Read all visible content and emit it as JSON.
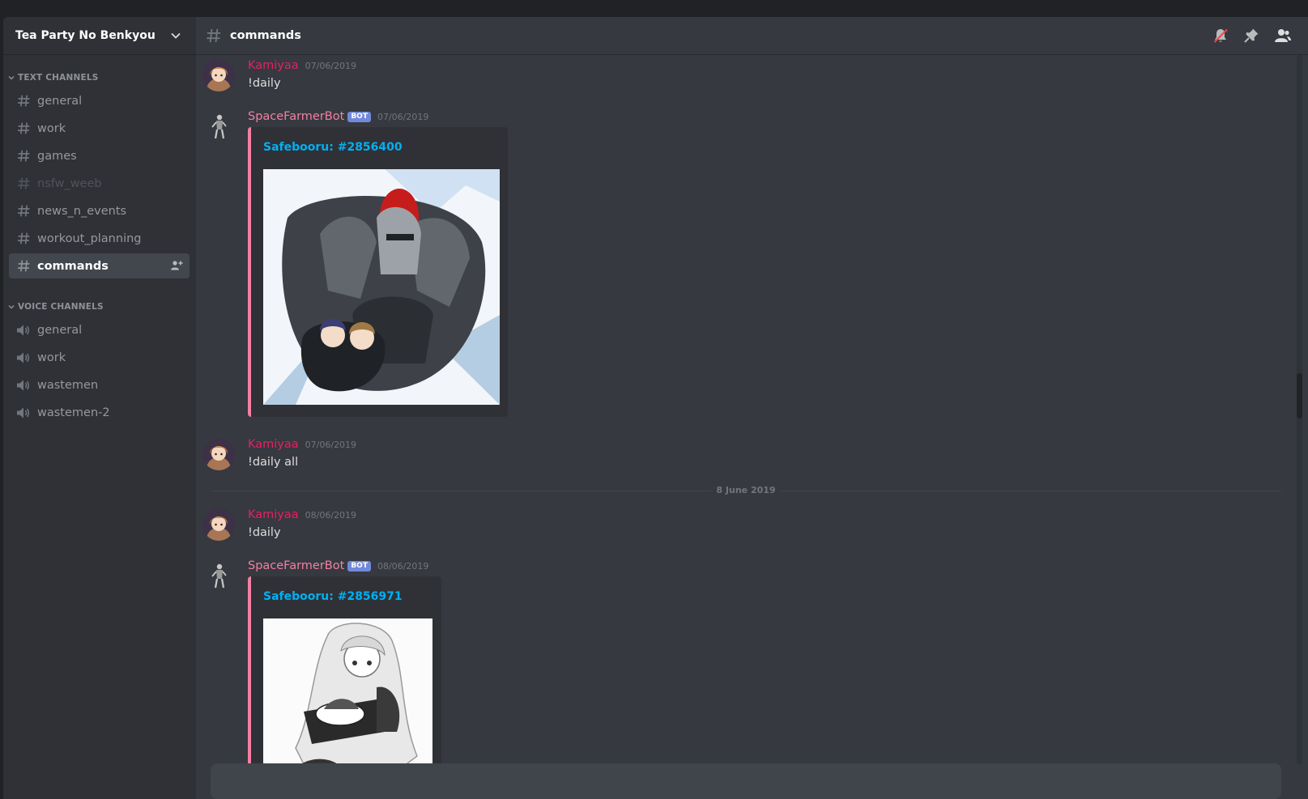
{
  "guild": {
    "name": "Tea Party No Benkyou"
  },
  "text_category": "TEXT CHANNELS",
  "text_channels": [
    {
      "label": "general"
    },
    {
      "label": "work"
    },
    {
      "label": "games"
    },
    {
      "label": "nsfw_weeb"
    },
    {
      "label": "news_n_events"
    },
    {
      "label": "workout_planning"
    },
    {
      "label": "commands"
    }
  ],
  "voice_category": "VOICE CHANNELS",
  "voice_channels": [
    {
      "label": "general"
    },
    {
      "label": "work"
    },
    {
      "label": "wastemen"
    },
    {
      "label": "wastemen-2"
    }
  ],
  "header": {
    "channel": "commands"
  },
  "bot_tag": "BOT",
  "messages": [
    {
      "author": "Kamiyaa",
      "timestamp": "07/06/2019",
      "text": "!daily"
    },
    {
      "author": "SpaceFarmerBot",
      "timestamp": "07/06/2019",
      "embed_title": "Safebooru: #2856400"
    },
    {
      "author": "Kamiyaa",
      "timestamp": "07/06/2019",
      "text": "!daily all"
    },
    {
      "author": "Kamiyaa",
      "timestamp": "08/06/2019",
      "text": "!daily"
    },
    {
      "author": "SpaceFarmerBot",
      "timestamp": "08/06/2019",
      "embed_title": "Safebooru: #2856971"
    }
  ],
  "date_divider": "8 June 2019",
  "colors": {
    "accent_pink": "#f47fa4",
    "user_pink": "#e91e63",
    "link_blue": "#00b0f4",
    "bot_badge": "#7289da"
  }
}
